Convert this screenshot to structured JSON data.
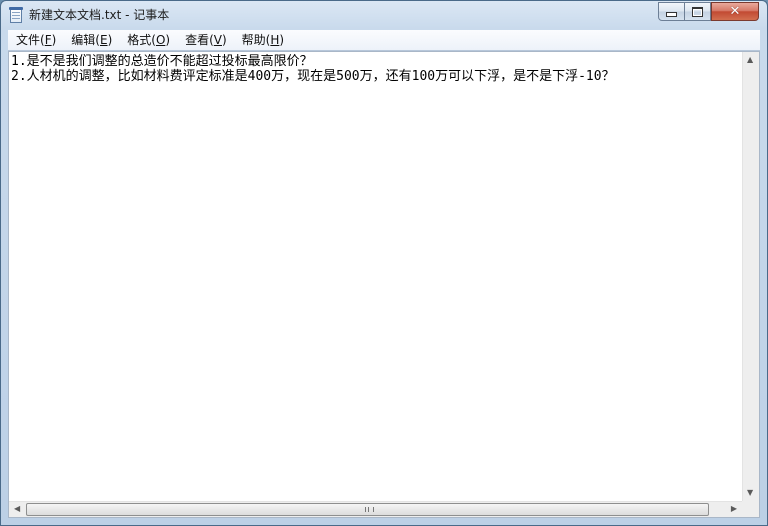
{
  "window": {
    "title": "新建文本文档.txt - 记事本",
    "icon": "notepad-icon",
    "caption": {
      "minimize": "minimize-icon",
      "maximize": "maximize-icon",
      "close_glyph": "✕"
    }
  },
  "menubar": {
    "items": [
      {
        "label": "文件(",
        "key": "F",
        "suffix": ")"
      },
      {
        "label": "编辑(",
        "key": "E",
        "suffix": ")"
      },
      {
        "label": "格式(",
        "key": "O",
        "suffix": ")"
      },
      {
        "label": "查看(",
        "key": "V",
        "suffix": ")"
      },
      {
        "label": "帮助(",
        "key": "H",
        "suffix": ")"
      }
    ]
  },
  "editor": {
    "lines": [
      "1.是不是我们调整的总造价不能超过投标最高限价？",
      "2.人材机的调整，比如材料费评定标准是400万，现在是500万，还有100万可以下浮，是不是下浮-10？"
    ]
  },
  "scrollbars": {
    "up_arrow": "▲",
    "down_arrow": "▼",
    "left_arrow": "◀",
    "right_arrow": "▶"
  }
}
